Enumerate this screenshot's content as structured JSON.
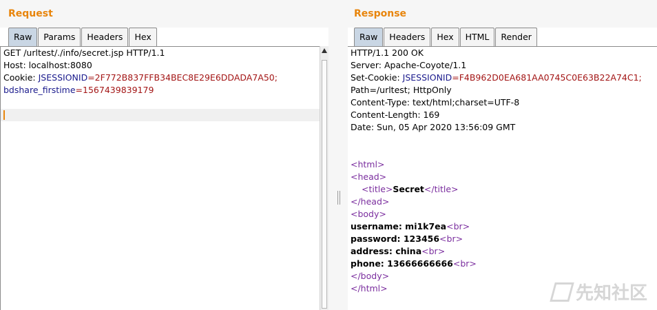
{
  "request": {
    "title": "Request",
    "tabs": [
      "Raw",
      "Params",
      "Headers",
      "Hex"
    ],
    "active_tab": "Raw",
    "lines": {
      "request_line": "GET /urltest/./info/secret.jsp HTTP/1.1",
      "host": "Host: localhost:8080",
      "cookie_prefix": "Cookie: ",
      "jsessionid_key": "JSESSIONID",
      "jsessionid_value": "=2F772B837FFB34BEC8E29E6DDADA7A50;",
      "bdshare_key": "bdshare_firstime",
      "bdshare_value": "=1567439839179"
    }
  },
  "response": {
    "title": "Response",
    "tabs": [
      "Raw",
      "Headers",
      "Hex",
      "HTML",
      "Render"
    ],
    "active_tab": "Raw",
    "lines": {
      "status": "HTTP/1.1 200 OK",
      "server": "Server: Apache-Coyote/1.1",
      "set_cookie_prefix": "Set-Cookie: ",
      "jsessionid_key": "JSESSIONID",
      "jsessionid_value": "=F4B962D0EA681AA0745C0E63B22A74C1;",
      "path": "Path=/urltest; HttpOnly",
      "content_type": "Content-Type: text/html;charset=UTF-8",
      "content_length": "Content-Length: 169",
      "date": "Date: Sun, 05 Apr 2020 13:56:09 GMT",
      "tag_html_open": "<html>",
      "tag_head_open": "<head>",
      "tag_title_open": "<title>",
      "title_text": "Secret",
      "tag_title_close": "</title>",
      "tag_head_close": "</head>",
      "tag_body_open": "<body>",
      "username": "username: mi1k7ea",
      "password": "password: 123456",
      "address": "address: china",
      "phone": "phone: 13666666666",
      "tag_br": "<br>",
      "tag_body_close": "</body>",
      "tag_html_close": "</html>"
    }
  },
  "watermark": {
    "text": "先知社区"
  }
}
